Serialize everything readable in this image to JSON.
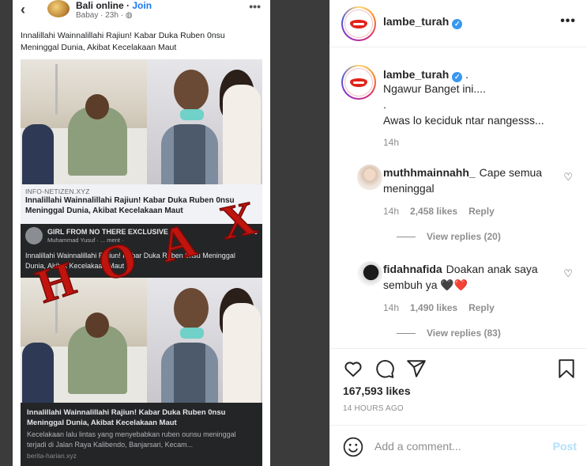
{
  "media": {
    "fb_page_name": "Bali online",
    "fb_join": "Join",
    "fb_meta": "Babay · 23h · ",
    "fb_post_text": "Innalillahi Wainnalillahi Rajiun! Kabar Duka Ruben 0nsu Meninggal Dunia, Akibat Kecelakaan Maut",
    "link_source": "INFO-NETIZEN.XYZ",
    "link_title": "Innalillahi Wainnalillahi Rajiun! Kabar Duka Ruben 0nsu Meninggal Dunia, Akibat Kecelakaan Maut",
    "shared_page_name": "GIRL FROM NO THERE EXCLUSIVE",
    "shared_author": "Muhammad Yusuf · ... ment ·",
    "shared_text": "Innalillahi Wainnalillahi Rajiun! Kabar Duka Ruben 0nsu Meninggal Dunia, Akibat Kecelakaan Maut",
    "card_title": "Innalillahi Wainnalillahi Rajiun! Kabar Duka Ruben 0nsu Meninggal Dunia, Akibat Kecelakaan Maut",
    "card_desc": "Kecelakaan lalu lintas yang menyebabkan ruben ounsu meninggal terjadi di Jalan Raya Kalibendo, Banjarsari, Kecam...",
    "card_source": "berita-harian.xyz",
    "stamp": "HOAX",
    "colors": {
      "stamp": "#c0140f",
      "fb_blue": "#1877f2"
    }
  },
  "header": {
    "username": "lambe_turah",
    "more_label": "•••"
  },
  "caption": {
    "username": "lambe_turah",
    "suffix": ".",
    "lines": [
      "Ngawur Banget ini....",
      ".",
      "Awas lo keciduk ntar nangesss..."
    ],
    "time": "14h"
  },
  "comments": [
    {
      "username": "muthhmainnahh_",
      "text": "Cape semua meninggal",
      "time": "14h",
      "likes": "2,458 likes",
      "reply": "Reply",
      "view_replies": "View replies (20)"
    },
    {
      "username": "fidahnafida",
      "text": "Doakan anak saya sembuh ya 🖤❤️",
      "time": "14h",
      "likes": "1,490 likes",
      "reply": "Reply",
      "view_replies": "View replies (83)"
    }
  ],
  "stats": {
    "likes": "167,593 likes",
    "timestamp": "14 HOURS AGO"
  },
  "composer": {
    "placeholder": "Add a comment...",
    "post_label": "Post"
  },
  "colors": {
    "verified": "#3897f0",
    "muted": "#8e8e8e",
    "post_disabled": "#b2dffc"
  }
}
